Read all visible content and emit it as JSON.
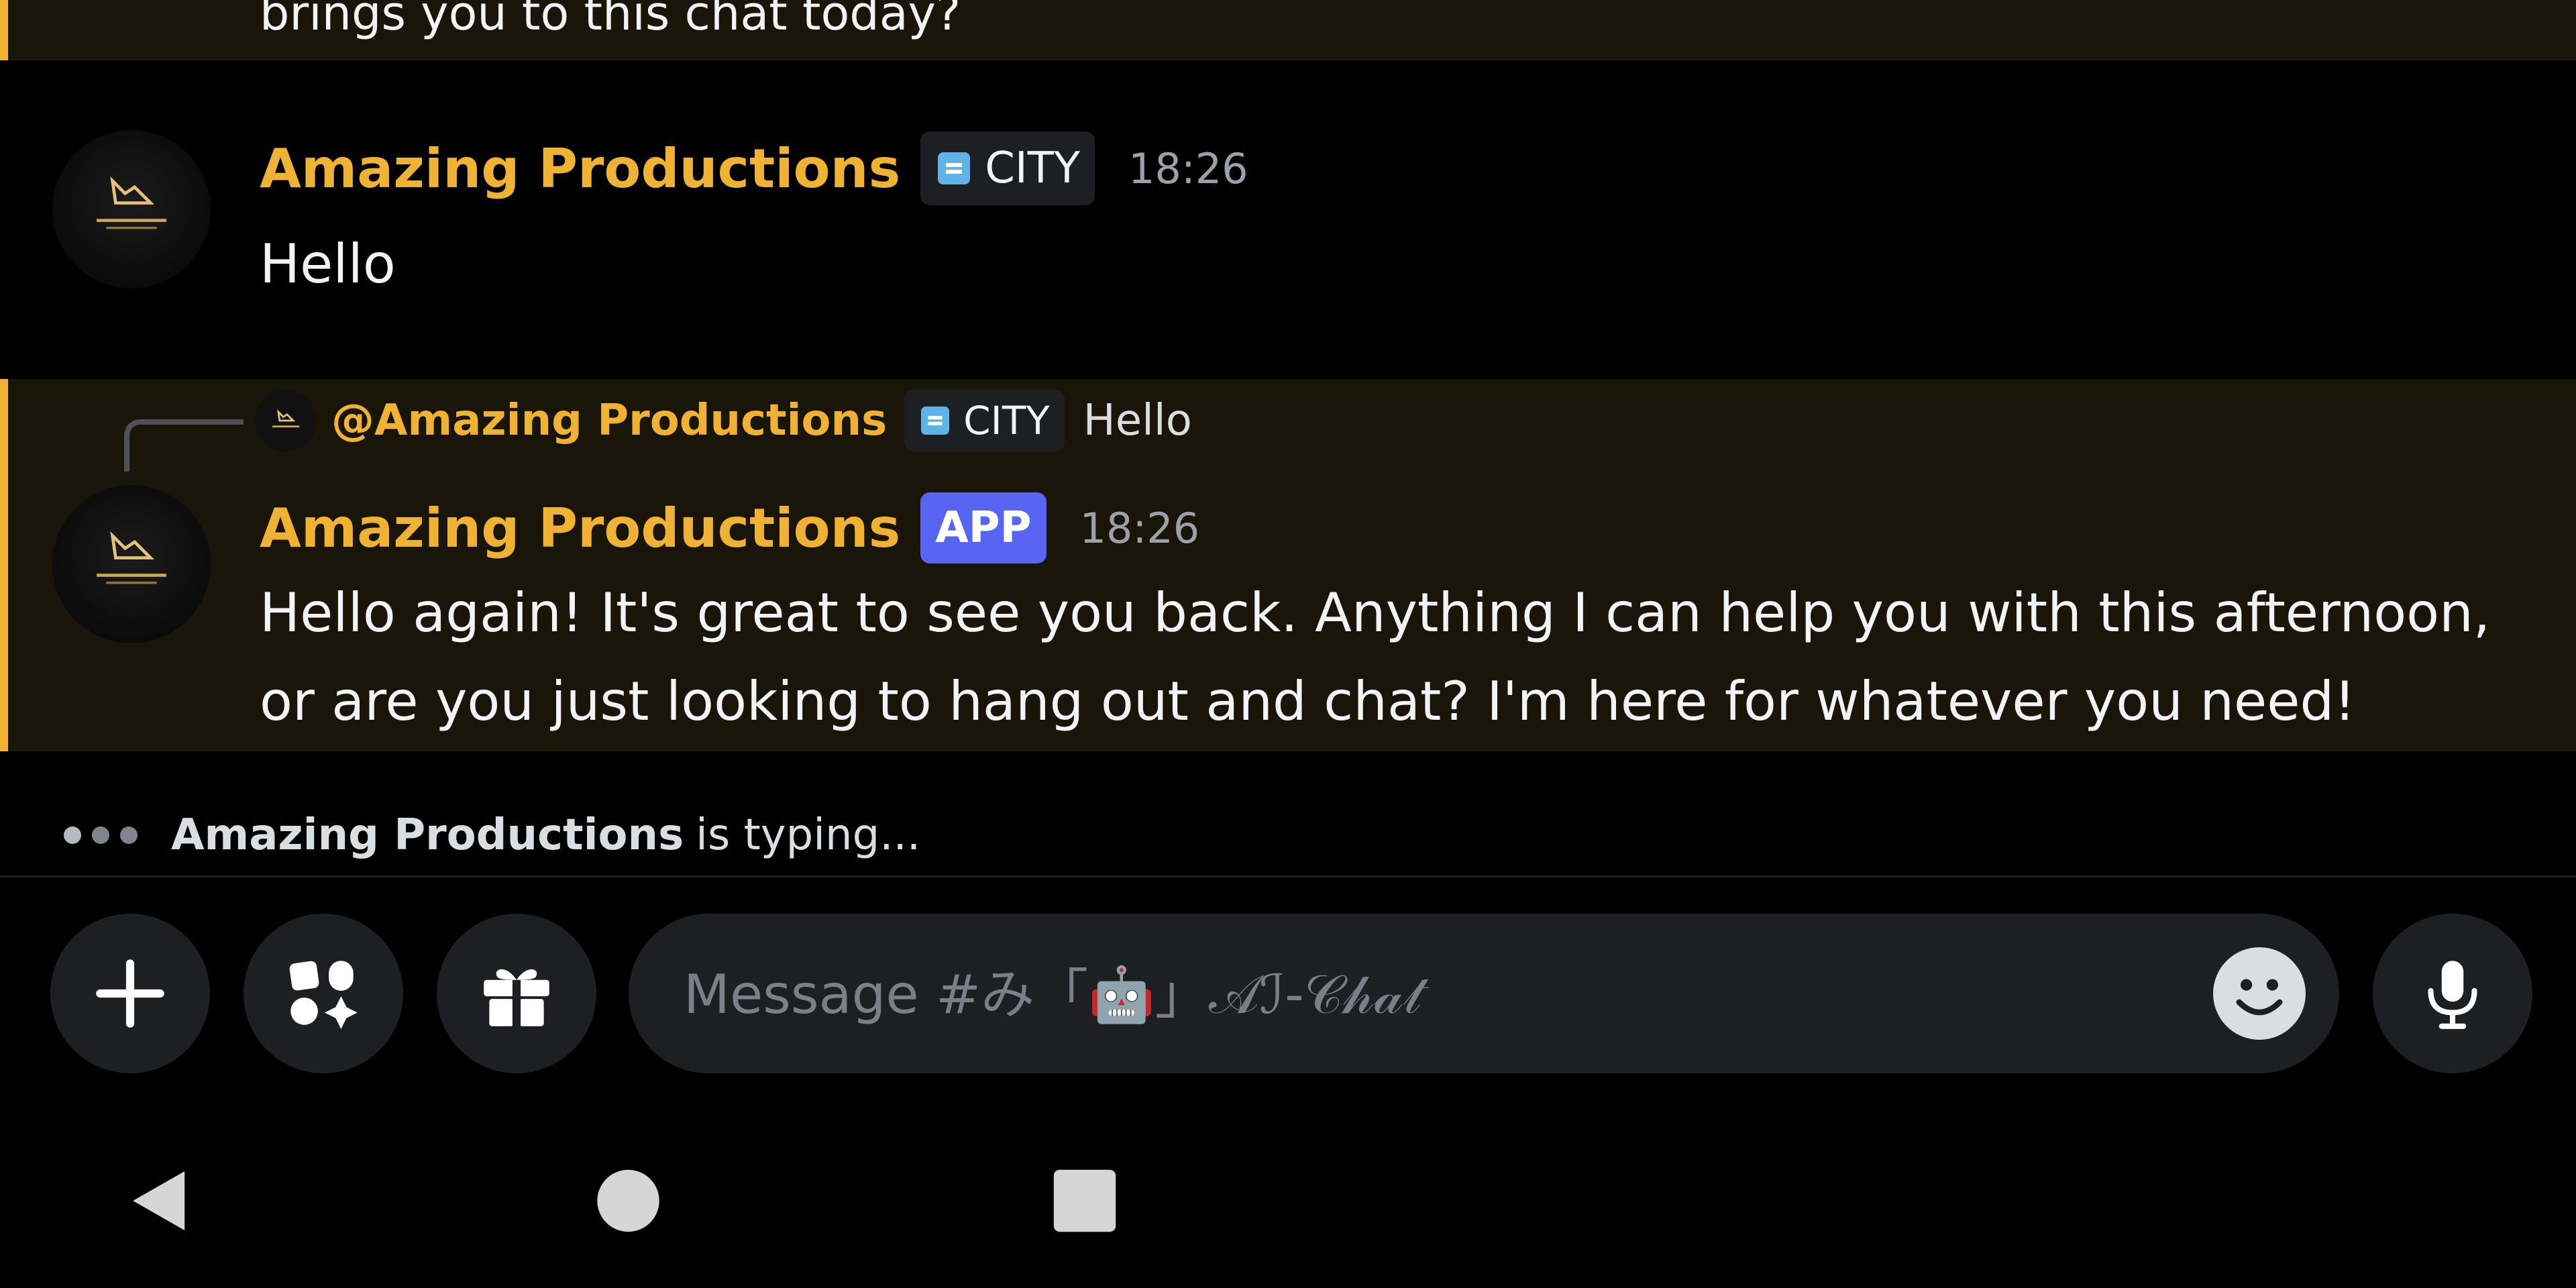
{
  "messages": {
    "previous_text": "brings you to this chat today?",
    "hello": {
      "author": "Amazing Productions",
      "tag": "CITY",
      "time": "18:26",
      "body": "Hello"
    },
    "reply": {
      "ref_author": "@Amazing Productions",
      "ref_tag": "CITY",
      "ref_snippet": "Hello",
      "author": "Amazing Productions",
      "badge": "APP",
      "time": "18:26",
      "body_line1": "Hello again! It's great to see you back. Anything I can help you with this afternoon,",
      "body_line2": "or are you just looking to hang out and chat? I'm here for whatever you need!"
    }
  },
  "typing": {
    "name": "Amazing Productions",
    "rest": "is typing..."
  },
  "composer": {
    "placeholder": "Message #み「🤖」𝒜ℐ-𝒞𝒽𝒶𝓉"
  },
  "icons": {
    "add": "plus-icon",
    "apps": "apps-icon",
    "gift": "gift-icon",
    "emoji": "emoji-icon",
    "mic": "microphone-icon",
    "nav_back": "back-triangle-icon",
    "nav_home": "home-circle-icon",
    "nav_recents": "recents-square-icon"
  },
  "colors": {
    "background": "#000000",
    "highlight_row": "#1a1509",
    "accent_bar": "#f0b232",
    "author_name": "#f0b232",
    "app_badge": "#5865f2",
    "input_bg": "#1e1f22"
  }
}
